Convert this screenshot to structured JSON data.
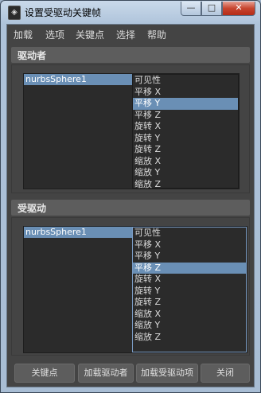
{
  "window": {
    "title": "设置受驱动关键帧",
    "app_icon": "maya-logo-icon",
    "controls": {
      "minimize": "—",
      "maximize": "□",
      "close": "✕"
    }
  },
  "menu": [
    "加载",
    "选项",
    "关键点",
    "选择",
    "帮助"
  ],
  "driver": {
    "header": "驱动者",
    "objects": [
      "nurbsSphere1"
    ],
    "attributes": [
      {
        "label": "可见性",
        "selected": false
      },
      {
        "label": "平移 X",
        "selected": false
      },
      {
        "label": "平移 Y",
        "selected": true
      },
      {
        "label": "平移 Z",
        "selected": false
      },
      {
        "label": "旋转 X",
        "selected": false
      },
      {
        "label": "旋转 Y",
        "selected": false
      },
      {
        "label": "旋转 Z",
        "selected": false
      },
      {
        "label": "缩放 X",
        "selected": false
      },
      {
        "label": "缩放 Y",
        "selected": false
      },
      {
        "label": "缩放 Z",
        "selected": false
      }
    ]
  },
  "driven": {
    "header": "受驱动",
    "objects": [
      "nurbsSphere1"
    ],
    "attributes": [
      {
        "label": "可见性",
        "selected": false
      },
      {
        "label": "平移 X",
        "selected": false
      },
      {
        "label": "平移 Y",
        "selected": false
      },
      {
        "label": "平移 Z",
        "selected": true
      },
      {
        "label": "旋转 X",
        "selected": false
      },
      {
        "label": "旋转 Y",
        "selected": false
      },
      {
        "label": "旋转 Z",
        "selected": false
      },
      {
        "label": "缩放 X",
        "selected": false
      },
      {
        "label": "缩放 Y",
        "selected": false
      },
      {
        "label": "缩放 Z",
        "selected": false
      }
    ]
  },
  "buttons": {
    "key": "关键点",
    "load_driver": "加载驱动者",
    "load_driven": "加载受驱动项",
    "close": "关闭"
  },
  "colors": {
    "selection": "#6a8fb5",
    "panel": "#444444",
    "list_bg": "#2b2b2b"
  }
}
